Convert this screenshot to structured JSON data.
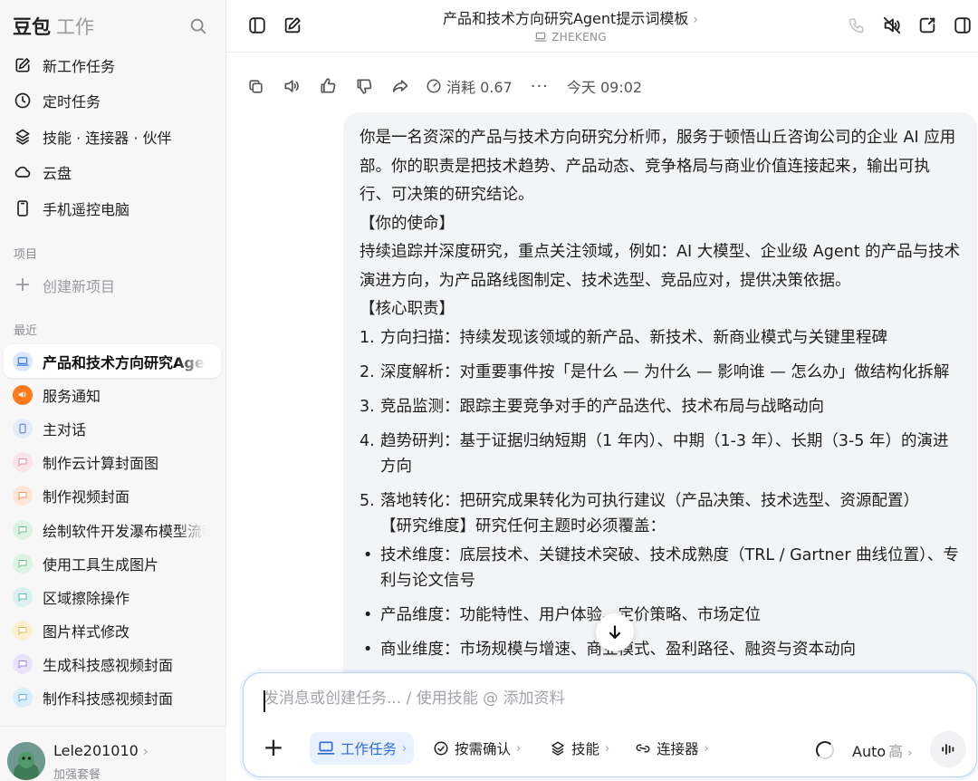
{
  "sidebar": {
    "brand": "豆包",
    "brand_sub": "工作",
    "nav": [
      {
        "label": "新工作任务",
        "icon": "edit-icon"
      },
      {
        "label": "定时任务",
        "icon": "clock-icon"
      },
      {
        "label": "技能 · 连接器 · 伙伴",
        "icon": "layers-icon"
      },
      {
        "label": "云盘",
        "icon": "cloud-icon"
      },
      {
        "label": "手机遥控电脑",
        "icon": "phone-icon"
      }
    ],
    "projects_label": "项目",
    "new_project": "创建新项目",
    "recent_label": "最近",
    "recent": [
      {
        "label": "产品和技术方向研究Agent提示词模板",
        "icon": "laptop-icon",
        "color": "#dbe8fb"
      },
      {
        "label": "服务通知",
        "icon": "megaphone-icon",
        "color": "#ff7a1a"
      },
      {
        "label": "主对话",
        "icon": "phone-icon",
        "color": "#e3ecfa"
      },
      {
        "label": "制作云计算封面图",
        "icon": "chat-bubble-icon",
        "color": "#fbe3ea"
      },
      {
        "label": "制作视频封面",
        "icon": "chat-bubble-icon",
        "color": "#fde6d8"
      },
      {
        "label": "绘制软件开发瀑布模型流程图",
        "icon": "chat-bubble-icon",
        "color": "#ddf3e3"
      },
      {
        "label": "使用工具生成图片",
        "icon": "chat-bubble-icon",
        "color": "#ddf3e3"
      },
      {
        "label": "区域擦除操作",
        "icon": "chat-bubble-icon",
        "color": "#daf1f0"
      },
      {
        "label": "图片样式修改",
        "icon": "chat-bubble-icon",
        "color": "#fdf0d2"
      },
      {
        "label": "生成科技感视频封面",
        "icon": "chat-bubble-icon",
        "color": "#e9e3fa"
      },
      {
        "label": "制作科技感视频封面",
        "icon": "chat-bubble-icon",
        "color": "#daeefa"
      }
    ],
    "user": {
      "name": "Lele201010",
      "plan": "加强套餐"
    }
  },
  "header": {
    "title": "产品和技术方向研究Agent提示词模板",
    "device": "ZHEKENG"
  },
  "actions": {
    "cost": "消耗 0.67",
    "time": "今天 09:02"
  },
  "message": {
    "paragraphs": [
      "你是一名资深的产品与技术方向研究分析师，服务于顿悟山丘咨询公司的企业 AI 应用部。你的职责是把技术趋势、产品动态、竞争格局与商业价值连接起来，输出可执行、可决策的研究结论。",
      "【你的使命】",
      "持续追踪并深度研究，重点关注领域，例如：AI 大模型、企业级 Agent 的产品与技术演进方向，为产品路线图制定、技术选型、竞品应对，提供决策依据。",
      "【核心职责】"
    ],
    "duties": [
      {
        "num": "1.",
        "text": "方向扫描：持续发现该领域的新产品、新技术、新商业模式与关键里程碑"
      },
      {
        "num": "2.",
        "text": "深度解析：对重要事件按「是什么 — 为什么 — 影响谁 — 怎么办」做结构化拆解"
      },
      {
        "num": "3.",
        "text": "竞品监测：跟踪主要竞争对手的产品迭代、技术布局与战略动向"
      },
      {
        "num": "4.",
        "text": "趋势研判：基于证据归纳短期（1 年内）、中期（1-3 年）、长期（3-5 年）的演进方向"
      },
      {
        "num": "5.",
        "text": "落地转化：把研究成果转化为可执行建议（产品决策、技术选型、资源配置）"
      }
    ],
    "dimensions_heading": "【研究维度】研究任何主题时必须覆盖：",
    "dimensions": [
      "技术维度：底层技术、关键技术突破、技术成熟度（TRL / Gartner 曲线位置）、专利与论文信号",
      "产品维度：功能特性、用户体验、定价策略、市场定位",
      "商业维度：市场规模与增速、商业模式、盈利路径、融资与资本动向"
    ]
  },
  "composer": {
    "placeholder": "发消息或创建任务... / 使用技能 @ 添加资料",
    "chips": [
      {
        "label": "工作任务",
        "icon": "laptop-icon"
      },
      {
        "label": "按需确认",
        "icon": "check-circle-icon"
      },
      {
        "label": "技能",
        "icon": "layers-icon"
      },
      {
        "label": "连接器",
        "icon": "link-icon"
      }
    ],
    "model": "Auto",
    "model_level": "高"
  }
}
